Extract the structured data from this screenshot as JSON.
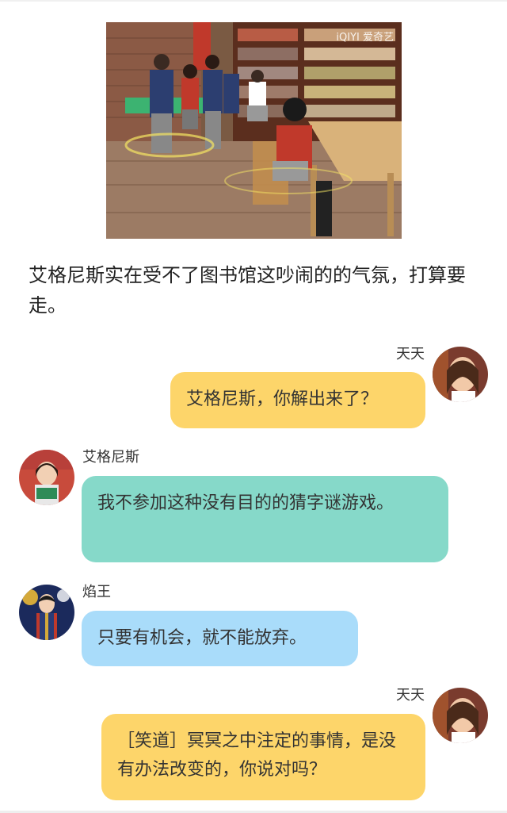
{
  "scene": {
    "watermark": "iQIYI 爱奇艺"
  },
  "narration": "艾格尼斯实在受不了图书馆这吵闹的的气氛，打算要走。",
  "messages": [
    {
      "speaker": "天天",
      "text": "艾格尼斯，你解出来了？",
      "side": "right",
      "color": "#fdd56a"
    },
    {
      "speaker": "艾格尼斯",
      "text": "我不参加这种没有目的的猜字谜游戏。",
      "side": "left",
      "color": "#86d9c9"
    },
    {
      "speaker": "焰王",
      "text": "只要有机会，就不能放弃。",
      "side": "left",
      "color": "#a9dcfa"
    },
    {
      "speaker": "天天",
      "text": "［笑道］冥冥之中注定的事情，是没有办法改变的，你说对吗？",
      "side": "right",
      "color": "#fdd56a"
    }
  ]
}
